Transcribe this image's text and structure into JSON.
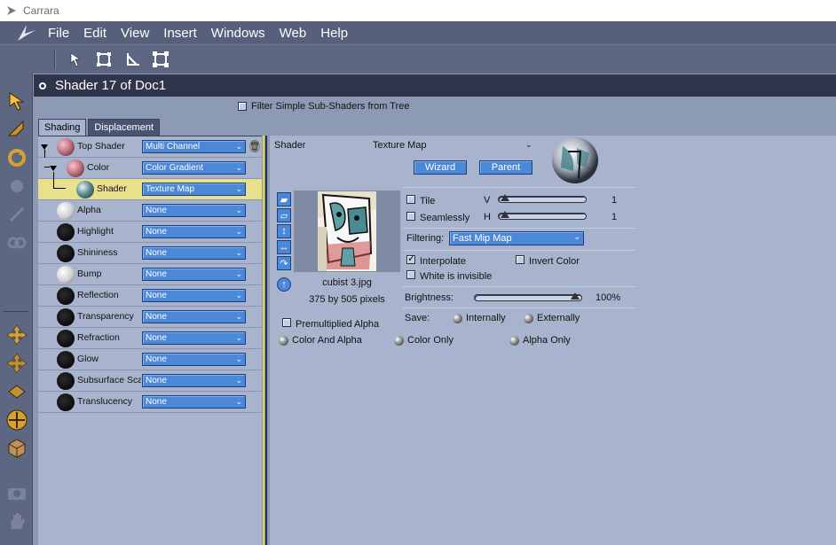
{
  "window": {
    "title": "Carrara"
  },
  "menu": [
    "File",
    "Edit",
    "View",
    "Insert",
    "Windows",
    "Web",
    "Help"
  ],
  "panel": {
    "title": "Shader 17 of Doc1",
    "filter_label": "Filter Simple Sub-Shaders from Tree"
  },
  "tabs": [
    {
      "label": "Shading",
      "active": true
    },
    {
      "label": "Displacement",
      "active": false
    }
  ],
  "tree": [
    {
      "label": "Top Shader",
      "value": "Multi Channel",
      "depth": 0,
      "ball": "pink"
    },
    {
      "label": "Color",
      "value": "Color Gradient",
      "depth": 1,
      "ball": "pink"
    },
    {
      "label": "Shader",
      "value": "Texture Map",
      "depth": 2,
      "ball": "texture",
      "selected": true
    },
    {
      "label": "Alpha",
      "value": "None",
      "depth": 0,
      "ball": "white"
    },
    {
      "label": "Highlight",
      "value": "None",
      "depth": 0,
      "ball": "black"
    },
    {
      "label": "Shininess",
      "value": "None",
      "depth": 0,
      "ball": "black"
    },
    {
      "label": "Bump",
      "value": "None",
      "depth": 0,
      "ball": "white"
    },
    {
      "label": "Reflection",
      "value": "None",
      "depth": 0,
      "ball": "black"
    },
    {
      "label": "Transparency",
      "value": "None",
      "depth": 0,
      "ball": "black"
    },
    {
      "label": "Refraction",
      "value": "None",
      "depth": 0,
      "ball": "black"
    },
    {
      "label": "Glow",
      "value": "None",
      "depth": 0,
      "ball": "black"
    },
    {
      "label": "Subsurface Scattering",
      "value": "None",
      "depth": 0,
      "ball": "black"
    },
    {
      "label": "Translucency",
      "value": "None",
      "depth": 0,
      "ball": "black"
    }
  ],
  "editor": {
    "shader_label": "Shader",
    "shader_type": "Texture Map",
    "wizard_label": "Wizard",
    "parent_label": "Parent",
    "image_name": "cubist 3.jpg",
    "image_size": "375 by 505 pixels",
    "tile_label": "Tile",
    "seamlessly_label": "Seamlessly",
    "v_label": "V",
    "h_label": "H",
    "v_value": "1",
    "h_value": "1",
    "filtering_label": "Filtering:",
    "filtering_value": "Fast Mip Map",
    "interpolate_label": "Interpolate",
    "interpolate_checked": true,
    "invert_color_label": "Invert Color",
    "white_invisible_label": "White is invisible",
    "brightness_label": "Brightness:",
    "brightness_value": "100%",
    "brightness_level": 1.0,
    "save_label": "Save:",
    "internally_label": "Internally",
    "externally_label": "Externally",
    "premultiplied_label": "Premultiplied Alpha",
    "color_and_alpha_label": "Color And Alpha",
    "color_only_label": "Color Only",
    "alpha_only_label": "Alpha Only"
  },
  "colors": {
    "background": "#8d9ab5",
    "panel_head": "#2f354a",
    "menubar": "#56607a",
    "dropdown": "#4b88d8",
    "selected_row": "#e8e08a"
  }
}
